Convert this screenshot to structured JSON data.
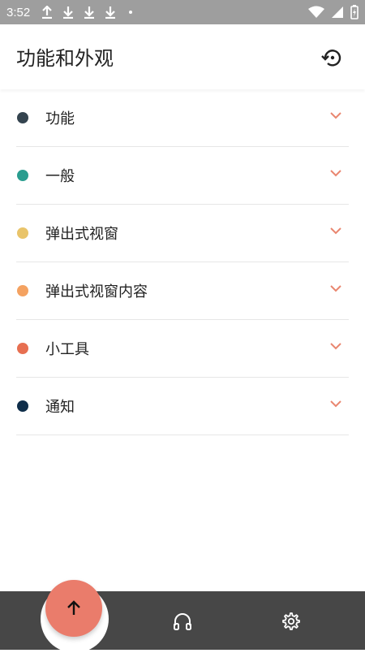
{
  "status_bar": {
    "time": "3:52"
  },
  "header": {
    "title": "功能和外观",
    "action_icon": "restore-history-icon"
  },
  "sections": [
    {
      "label": "功能",
      "color": "#34444f"
    },
    {
      "label": "一般",
      "color": "#2a9d8f"
    },
    {
      "label": "弹出式视窗",
      "color": "#e9c46a"
    },
    {
      "label": "弹出式视窗内容",
      "color": "#f4a261"
    },
    {
      "label": "小工具",
      "color": "#e76f51"
    },
    {
      "label": "通知",
      "color": "#0f2e4a"
    }
  ],
  "colors": {
    "accent": "#ea7c6b",
    "nav_bg": "#474747",
    "chevron": "#e9866f"
  },
  "bottom_nav": {
    "fab_icon": "arrow-up-icon",
    "items": [
      "headphones-icon",
      "gear-icon"
    ]
  }
}
